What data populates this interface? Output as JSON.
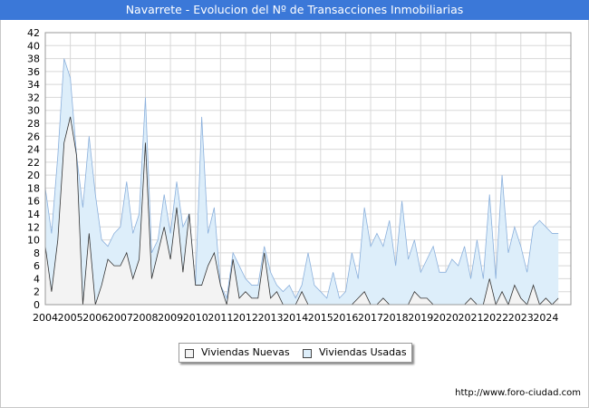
{
  "header": {
    "title": "Navarrete - Evolucion del Nº de Transacciones Inmobiliarias"
  },
  "footer": {
    "url": "http://www.foro-ciudad.com"
  },
  "colors": {
    "title_bg": "#3b78d8",
    "usadas_fill": "#ddeefa",
    "usadas_line": "#8bb0dc",
    "nuevas_fill": "#f3f3f3",
    "nuevas_line": "#333333",
    "grid": "#d8d8d8"
  },
  "chart_data": {
    "type": "area",
    "title": "Navarrete - Evolucion del Nº de Transacciones Inmobiliarias",
    "xlabel": "",
    "ylabel": "",
    "ylim": [
      0,
      42
    ],
    "yticks": [
      0,
      2,
      4,
      6,
      8,
      10,
      12,
      14,
      16,
      18,
      20,
      22,
      24,
      26,
      28,
      30,
      32,
      34,
      36,
      38,
      40,
      42
    ],
    "x_tick_labels": [
      "2004",
      "2005",
      "2006",
      "2007",
      "2008",
      "2009",
      "2010",
      "2011",
      "2012",
      "2013",
      "2014",
      "2015",
      "2016",
      "2017",
      "2018",
      "2019",
      "2020",
      "2021",
      "2022",
      "2023",
      "2024"
    ],
    "x_start": 2004,
    "points_per_year": 4,
    "grid": true,
    "legend_position": "bottom",
    "series": [
      {
        "name": "Viviendas Usadas",
        "values": [
          18,
          11,
          23,
          38,
          35,
          23,
          15,
          26,
          17,
          10,
          9,
          11,
          12,
          19,
          11,
          14,
          32,
          8,
          10,
          17,
          11,
          19,
          12,
          14,
          3,
          29,
          11,
          15,
          3,
          1,
          8,
          6,
          4,
          3,
          3,
          9,
          5,
          3,
          2,
          3,
          1,
          3,
          8,
          3,
          2,
          1,
          5,
          1,
          2,
          8,
          4,
          15,
          9,
          11,
          9,
          13,
          6,
          16,
          7,
          10,
          5,
          7,
          9,
          5,
          5,
          7,
          6,
          9,
          4,
          10,
          4,
          17,
          4,
          20,
          8,
          12,
          9,
          5,
          12,
          13,
          12,
          11,
          11
        ]
      },
      {
        "name": "Viviendas Nuevas",
        "values": [
          9,
          2,
          10,
          25,
          29,
          23,
          0,
          11,
          0,
          3,
          7,
          6,
          6,
          8,
          4,
          7,
          25,
          4,
          8,
          12,
          7,
          15,
          5,
          14,
          3,
          3,
          6,
          8,
          3,
          0,
          7,
          1,
          2,
          1,
          1,
          8,
          1,
          2,
          0,
          0,
          0,
          2,
          0,
          0,
          0,
          0,
          0,
          0,
          0,
          0,
          1,
          2,
          0,
          0,
          1,
          0,
          0,
          0,
          0,
          2,
          1,
          1,
          0,
          0,
          0,
          0,
          0,
          0,
          1,
          0,
          0,
          4,
          0,
          2,
          0,
          3,
          1,
          0,
          3,
          0,
          1,
          0,
          1
        ]
      }
    ]
  }
}
